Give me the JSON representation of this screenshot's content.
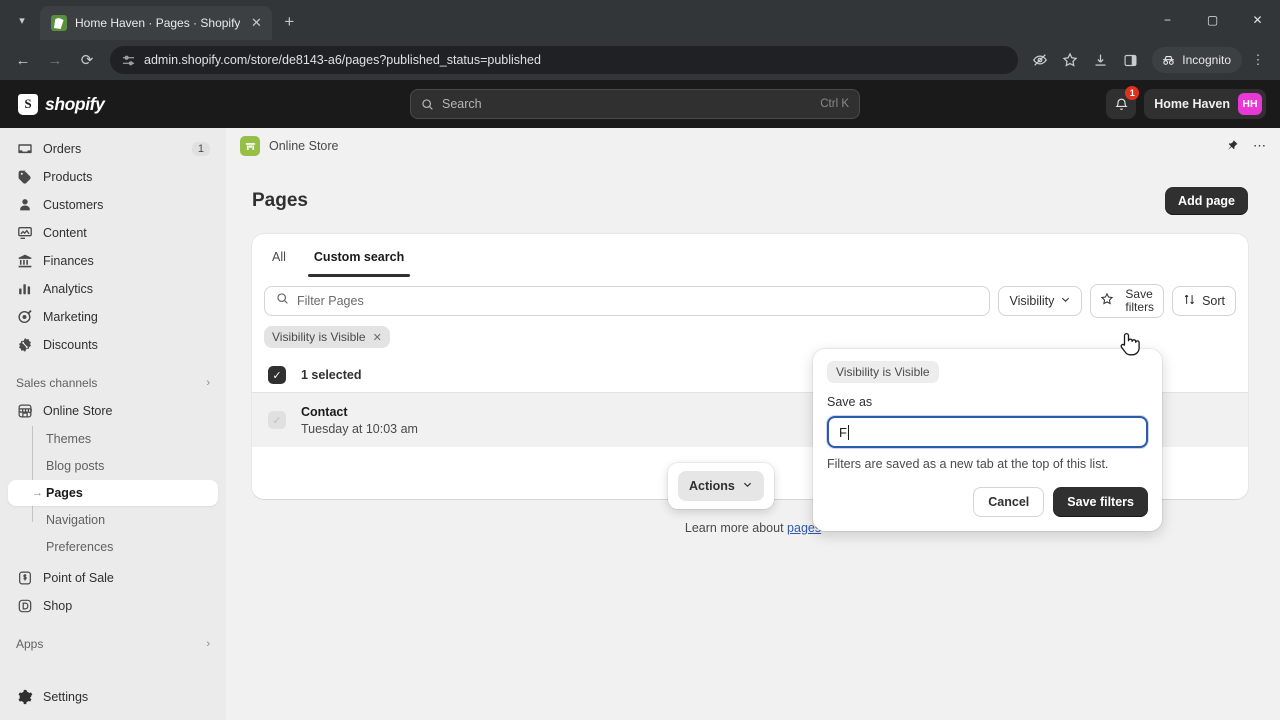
{
  "browser": {
    "tab": {
      "title": "Home Haven · Pages · Shopify",
      "favicon": "shopify-favicon",
      "close": "✕"
    },
    "new_tab": "+",
    "tab_list": "▾",
    "nav": {
      "back": "←",
      "forward": "→",
      "reload": "⟳"
    },
    "address": {
      "url": "admin.shopify.com/store/de8143-a6/pages?published_status=published"
    },
    "toolbar_icons": [
      "eye-off-icon",
      "star-icon",
      "download-icon",
      "side-panel-icon"
    ],
    "incognito_label": "Incognito",
    "menu": "⋮",
    "window": {
      "minimize": "−",
      "maximize": "▢",
      "close": "✕"
    }
  },
  "topbar": {
    "logo_text": "shopify",
    "search_placeholder": "Search",
    "search_shortcut": "Ctrl K",
    "notification_count": "1",
    "store_name": "Home Haven",
    "store_initials": "HH"
  },
  "sidebar": {
    "items": [
      {
        "label": "Orders",
        "icon": "orders-icon",
        "badge": "1"
      },
      {
        "label": "Products",
        "icon": "products-icon",
        "badge": ""
      },
      {
        "label": "Customers",
        "icon": "customers-icon",
        "badge": ""
      },
      {
        "label": "Content",
        "icon": "content-icon",
        "badge": ""
      },
      {
        "label": "Finances",
        "icon": "finances-icon",
        "badge": ""
      },
      {
        "label": "Analytics",
        "icon": "analytics-icon",
        "badge": ""
      },
      {
        "label": "Marketing",
        "icon": "marketing-icon",
        "badge": ""
      },
      {
        "label": "Discounts",
        "icon": "discounts-icon",
        "badge": ""
      }
    ],
    "sales_channels_label": "Sales channels",
    "online_store": "Online Store",
    "sub_items": [
      {
        "label": "Themes",
        "active": false
      },
      {
        "label": "Blog posts",
        "active": false
      },
      {
        "label": "Pages",
        "active": true
      },
      {
        "label": "Navigation",
        "active": false
      },
      {
        "label": "Preferences",
        "active": false
      }
    ],
    "channels": [
      {
        "label": "Point of Sale",
        "icon": "pos-icon"
      },
      {
        "label": "Shop",
        "icon": "shop-icon"
      }
    ],
    "apps_label": "Apps",
    "settings_label": "Settings"
  },
  "main": {
    "breadcrumb": "Online Store",
    "page_title": "Pages",
    "add_page_label": "Add page",
    "pin_icon": "pin-icon",
    "more_icon": "ellipsis-icon",
    "tabs": [
      {
        "label": "All",
        "active": false
      },
      {
        "label": "Custom search",
        "active": true
      }
    ],
    "filter_placeholder": "Filter Pages",
    "visibility_label": "Visibility",
    "save_filters_line1": "Save",
    "save_filters_line2": "filters",
    "sort_label": "Sort",
    "applied_filter_chip": "Visibility is Visible",
    "applied_filter_remove": "✕",
    "selected_label": "1 selected",
    "rows": [
      {
        "title": "Contact",
        "subtitle": "Tuesday at 10:03 am"
      }
    ],
    "actions_label": "Actions",
    "footer_prefix": "Learn more about",
    "footer_link": "pages"
  },
  "popover": {
    "chip": "Visibility is Visible",
    "save_as_label": "Save as",
    "input_value": "F",
    "help_text": "Filters are saved as a new tab at the top of this list.",
    "cancel_label": "Cancel",
    "save_label": "Save filters"
  },
  "colors": {
    "accent": "#2e5aac",
    "brand_green": "#95bf47",
    "avatar": "#e838d6",
    "badge_red": "#e0301e",
    "dark": "#303030"
  }
}
